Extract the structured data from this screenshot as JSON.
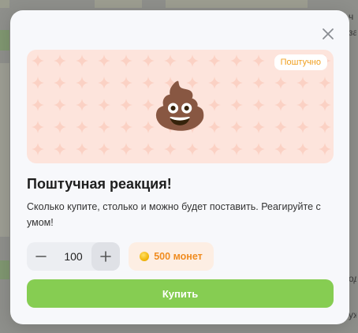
{
  "modal": {
    "badge": "Поштучно",
    "emoji": "💩",
    "title": "Поштучная реакция!",
    "description": "Сколько купите, столько и можно будет поставить. Реагируйте с умом!",
    "quantity": "100",
    "price": "500 монет",
    "buy_label": "Купить",
    "accent_color": "#86cd52",
    "badge_color": "#f0a020",
    "price_color": "#f08c20",
    "banner_color": "#fde4dc"
  },
  "icons": {
    "close": "close-icon",
    "minus": "minus-icon",
    "plus": "plus-icon",
    "coin": "coin-icon"
  },
  "background": {
    "right_edge_text": [
      "ч",
      "за",
      "од",
      "уж"
    ]
  }
}
